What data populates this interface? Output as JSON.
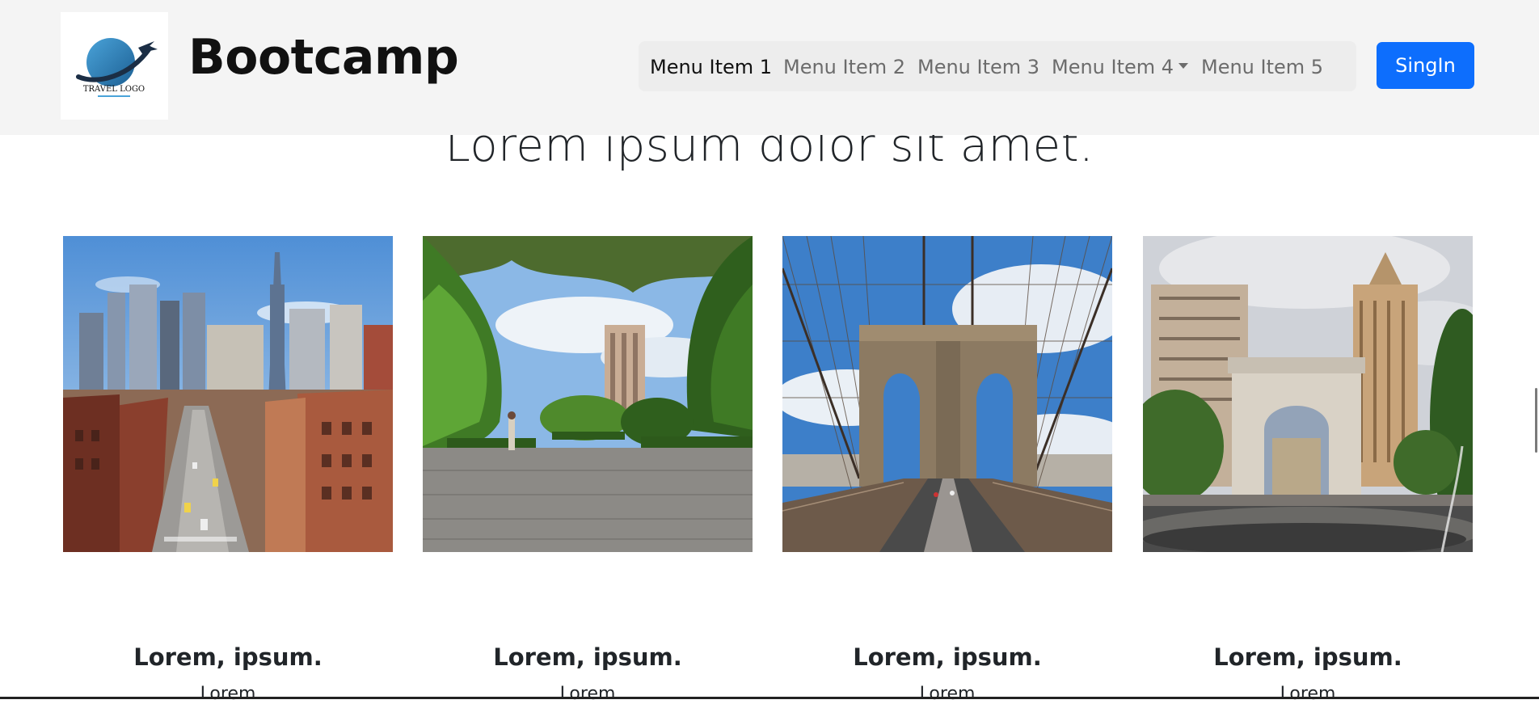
{
  "navbar": {
    "logo_text": "TRAVEL LOGO",
    "brand": "Bootcamp",
    "menu": [
      {
        "label": "Menu Item 1",
        "active": true
      },
      {
        "label": "Menu Item 2",
        "active": false
      },
      {
        "label": "Menu Item 3",
        "active": false
      },
      {
        "label": "Menu Item 4",
        "active": false,
        "dropdown": true
      },
      {
        "label": "Menu Item 5",
        "active": false
      }
    ],
    "signin_label": "SingIn"
  },
  "main": {
    "heading": "Lorem ipsum dolor sit amet.",
    "cards": [
      {
        "image": "city street skyline",
        "title": "Lorem, ipsum.",
        "text": "Lorem"
      },
      {
        "image": "park path with trees",
        "title": "Lorem, ipsum.",
        "text": "Lorem"
      },
      {
        "image": "suspension bridge",
        "title": "Lorem, ipsum.",
        "text": "Lorem"
      },
      {
        "image": "arch in square with fountain",
        "title": "Lorem, ipsum.",
        "text": "Lorem"
      }
    ]
  },
  "colors": {
    "navbar_bg": "#f4f4f4",
    "signin_bg": "#0d6efd",
    "text": "#212529",
    "nav_inactive": "#6c6c6c"
  }
}
